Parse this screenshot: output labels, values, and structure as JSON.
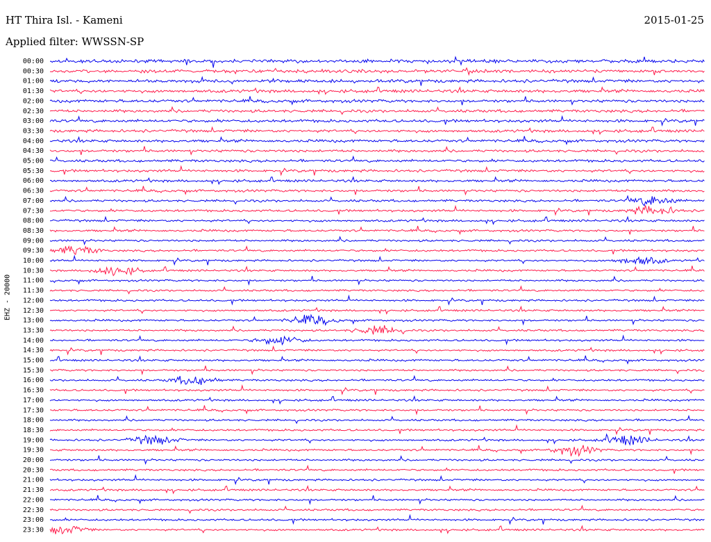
{
  "header": {
    "station": "HT Thira Isl. - Kameni",
    "date": "2015-01-25",
    "filter": "Applied filter: WWSSN-SP",
    "channel": "EHZ - 20000"
  },
  "colors": {
    "odd_trace": "#0000ee",
    "even_trace": "#ff1a4a",
    "background": "#ffffff"
  },
  "chart_data": {
    "type": "line",
    "title": "HT Thira Isl. - Kameni",
    "ylabel": "EHZ - 20000",
    "row_labels": [
      "00:00",
      "00:30",
      "01:00",
      "01:30",
      "02:00",
      "02:30",
      "03:00",
      "03:30",
      "04:00",
      "04:30",
      "05:00",
      "05:30",
      "06:00",
      "06:30",
      "07:00",
      "07:30",
      "08:00",
      "08:30",
      "09:00",
      "09:30",
      "10:00",
      "10:30",
      "11:00",
      "11:30",
      "12:00",
      "12:30",
      "13:00",
      "13:30",
      "14:00",
      "14:30",
      "15:00",
      "15:30",
      "16:00",
      "16:30",
      "17:00",
      "17:30",
      "18:00",
      "18:30",
      "19:00",
      "19:30",
      "20:00",
      "20:30",
      "21:00",
      "21:30",
      "22:00",
      "22:30",
      "23:00",
      "23:30"
    ],
    "series_colors": [
      "blue",
      "red",
      "alternating"
    ],
    "events": [
      {
        "row": "07:00",
        "t_frac": 0.92
      },
      {
        "row": "07:30",
        "t_frac": 0.92
      },
      {
        "row": "09:30",
        "t_frac": 0.04
      },
      {
        "row": "10:00",
        "t_frac": 0.9
      },
      {
        "row": "10:30",
        "t_frac": 0.1
      },
      {
        "row": "13:00",
        "t_frac": 0.4
      },
      {
        "row": "13:30",
        "t_frac": 0.5
      },
      {
        "row": "14:00",
        "t_frac": 0.35
      },
      {
        "row": "16:00",
        "t_frac": 0.22
      },
      {
        "row": "19:00",
        "t_frac": 0.16
      },
      {
        "row": "19:00",
        "t_frac": 0.88
      },
      {
        "row": "19:30",
        "t_frac": 0.8
      },
      {
        "row": "23:30",
        "t_frac": 0.02
      }
    ]
  }
}
